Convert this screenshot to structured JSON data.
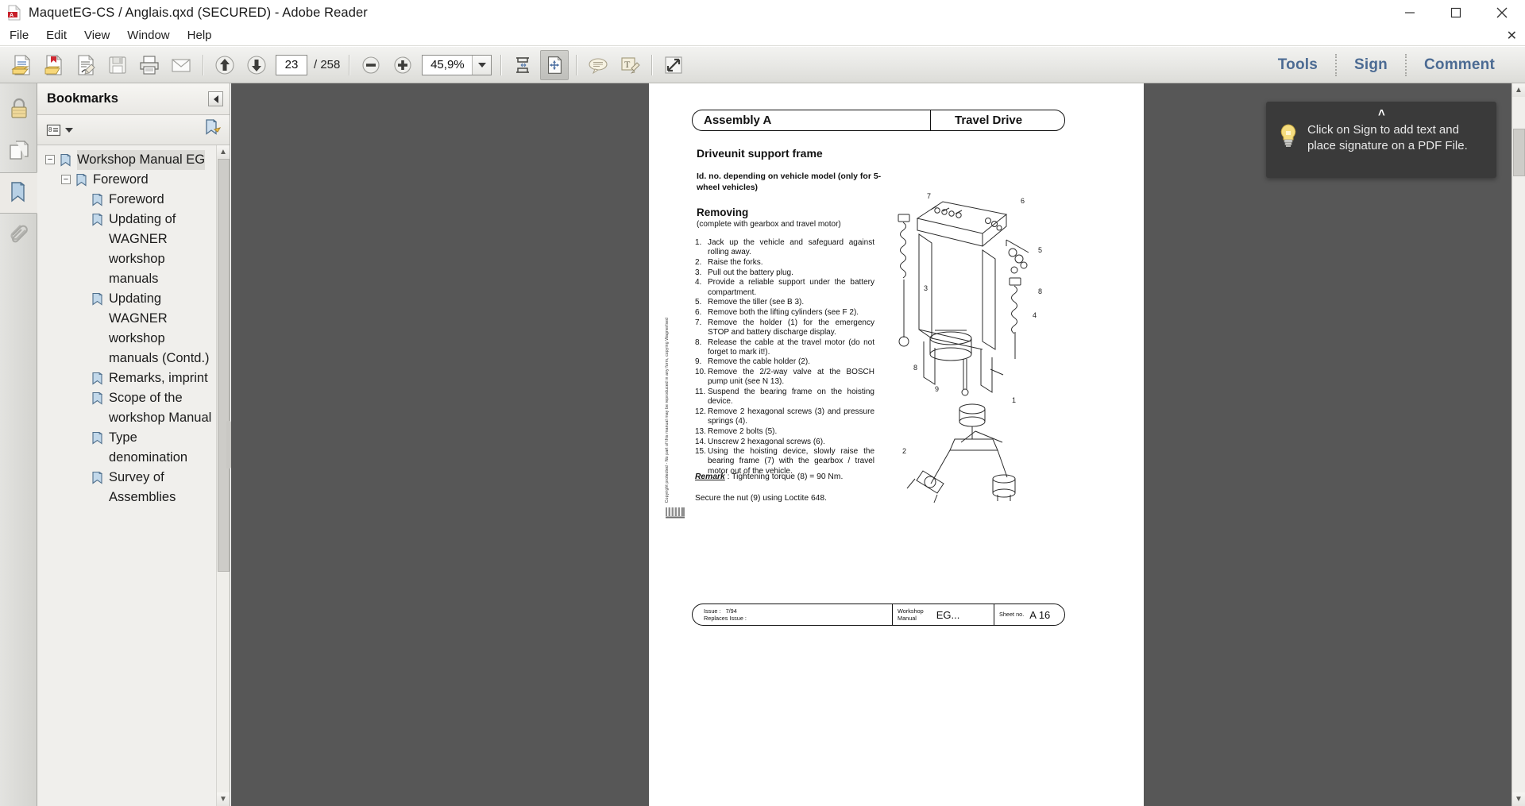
{
  "window": {
    "title": "MaquetEG-CS / Anglais.qxd (SECURED) - Adobe Reader",
    "app_icon": "adobe-pdf-icon",
    "minimize": "minimize-icon",
    "maximize": "maximize-icon",
    "close": "close-icon"
  },
  "menubar": {
    "items": [
      {
        "label": "File"
      },
      {
        "label": "Edit"
      },
      {
        "label": "View"
      },
      {
        "label": "Window"
      },
      {
        "label": "Help"
      }
    ],
    "close_label": "✕"
  },
  "toolbar": {
    "buttons": [
      {
        "name": "open-file-icon"
      },
      {
        "name": "create-pdf-icon"
      },
      {
        "name": "sign-document-icon"
      },
      {
        "name": "save-icon"
      },
      {
        "name": "print-icon"
      },
      {
        "name": "email-icon"
      },
      {
        "name": "previous-page-icon"
      },
      {
        "name": "next-page-icon"
      },
      {
        "name": "zoom-out-icon"
      },
      {
        "name": "zoom-in-icon"
      },
      {
        "name": "fit-width-icon"
      },
      {
        "name": "fit-page-icon"
      },
      {
        "name": "comment-balloon-icon"
      },
      {
        "name": "highlight-text-icon"
      },
      {
        "name": "full-screen-icon"
      }
    ],
    "page_current": "23",
    "page_total": "/ 258",
    "zoom_value": "45,9%",
    "right_items": [
      {
        "label": "Tools"
      },
      {
        "label": "Sign"
      },
      {
        "label": "Comment"
      }
    ]
  },
  "rail": {
    "items": [
      {
        "name": "security-lock-icon",
        "active": false
      },
      {
        "name": "page-thumbnails-icon",
        "active": false
      },
      {
        "name": "bookmarks-icon",
        "active": true
      },
      {
        "name": "attachments-paperclip-icon",
        "active": false
      }
    ]
  },
  "bookmarks": {
    "title": "Bookmarks",
    "collapse_icon": "collapse-panel-icon",
    "options_icon": "bookmark-options-icon",
    "options_caret": "chevron-down-icon",
    "new_bookmark_icon": "new-bookmark-icon",
    "tree": [
      {
        "label": "Workshop Manual EG",
        "depth": 0,
        "twisty": "−",
        "selected": true
      },
      {
        "label": "Foreword",
        "depth": 1,
        "twisty": "−",
        "selected": false
      },
      {
        "label": "Foreword",
        "depth": 2,
        "twisty": "",
        "selected": false
      },
      {
        "label": "Updating of WAGNER workshop manuals",
        "depth": 2,
        "twisty": "",
        "selected": false
      },
      {
        "label": "Updating WAGNER workshop manuals (Contd.)",
        "depth": 2,
        "twisty": "",
        "selected": false
      },
      {
        "label": "Remarks, imprint",
        "depth": 2,
        "twisty": "",
        "selected": false
      },
      {
        "label": "Scope of the workshop Manual",
        "depth": 2,
        "twisty": "",
        "selected": false
      },
      {
        "label": "Type denomination",
        "depth": 2,
        "twisty": "",
        "selected": false
      },
      {
        "label": "Survey of Assemblies",
        "depth": 2,
        "twisty": "",
        "selected": false
      }
    ],
    "scroll_up": "▲",
    "scroll_down": "▼"
  },
  "tooltip": {
    "arrow": "˄",
    "icon": "lightbulb-icon",
    "text": "Click on Sign to add text and place signature on a PDF File."
  },
  "document": {
    "header_left": "Assembly A",
    "header_right": "Travel Drive",
    "title": "Driveunit support frame",
    "subnote": "Id. no. depending on vehicle model (only for 5-wheel vehicles)",
    "section_heading": "Removing",
    "section_sub": "(complete with gearbox and travel motor)",
    "steps": [
      {
        "num": "1.",
        "text": "Jack up the vehicle and safeguard against rolling away."
      },
      {
        "num": "2.",
        "text": "Raise the forks."
      },
      {
        "num": "3.",
        "text": "Pull out the battery plug."
      },
      {
        "num": "4.",
        "text": "Provide a reliable support under the battery compartment."
      },
      {
        "num": "5.",
        "text": "Remove the tiller (see B 3)."
      },
      {
        "num": "6.",
        "text": "Remove both the lifting cylinders (see F 2)."
      },
      {
        "num": "7.",
        "text": "Remove the holder (1) for the emergency STOP and battery discharge display."
      },
      {
        "num": "8.",
        "text": "Release the cable at the travel motor (do not forget to mark it!)."
      },
      {
        "num": "9.",
        "text": "Remove the cable holder (2)."
      },
      {
        "num": "10.",
        "text": "Remove the 2/2-way valve at the BOSCH pump unit (see N 13)."
      },
      {
        "num": "11.",
        "text": "Suspend the bearing frame on the hoisting device."
      },
      {
        "num": "12.",
        "text": "Remove 2 hexagonal screws (3) and pressure springs (4)."
      },
      {
        "num": "13.",
        "text": "Remove 2 bolts (5)."
      },
      {
        "num": "14.",
        "text": "Unscrew 2 hexagonal screws (6)."
      },
      {
        "num": "15.",
        "text": "Using the hoisting device, slowly raise the bearing frame (7) with the gearbox / travel motor out of the vehicle."
      }
    ],
    "remark_label": "Remark",
    "remark_text": " :  Tightening torque (8) = 90 Nm.",
    "secure_text": "Secure the nut (9) using Loctite 648.",
    "vertical_copyright": "Copyright protected - No part of this manual may be reproduced in any form, copying Wagner/sed",
    "logo_name": "wagner-logo",
    "diagram_callouts": [
      "1",
      "2",
      "3",
      "4",
      "5",
      "6",
      "7",
      "8",
      "9"
    ],
    "footer": {
      "issue_label": "Issue :",
      "issue_value": "7/94",
      "replaces_label": "Replaces Issue :",
      "manual_label_1": "Workshop",
      "manual_label_2": "Manual",
      "manual_value": "EG...",
      "sheet_label": "Sheet no.",
      "sheet_value": "A 16"
    }
  },
  "colors": {
    "accent": "#4c6b93",
    "doc_background": "#575757",
    "toolbar_bg": "#e7e7e4",
    "panel_bg": "#f0efec",
    "tooltip_bg": "#3a3a3a"
  }
}
